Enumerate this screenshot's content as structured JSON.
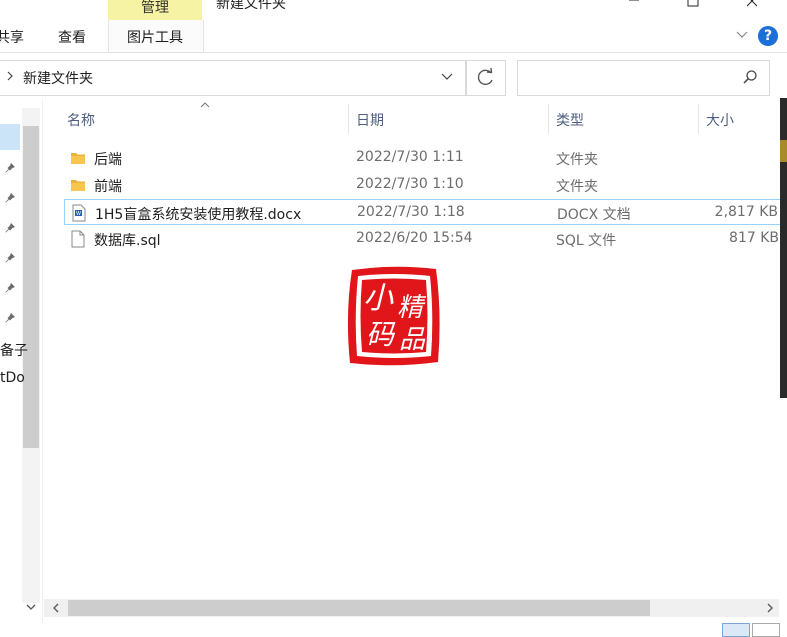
{
  "window": {
    "title": "新建文件夹",
    "context_tab": "管理",
    "context_group": "图片工具",
    "tabs": [
      "共享",
      "查看"
    ]
  },
  "address": {
    "path": "新建文件夹",
    "search_placeholder": ""
  },
  "columns": {
    "name": "名称",
    "date": "日期",
    "type": "类型",
    "size": "大小"
  },
  "files": [
    {
      "name": "后端",
      "date": "2022/7/30 1:11",
      "type": "文件夹",
      "size": "",
      "icon": "folder-icon"
    },
    {
      "name": "前端",
      "date": "2022/7/30 1:10",
      "type": "文件夹",
      "size": "",
      "icon": "folder-icon"
    },
    {
      "name": "1H5盲盒系统安装使用教程.docx",
      "date": "2022/7/30 1:18",
      "type": "DOCX 文档",
      "size": "2,817 KB",
      "icon": "word-document-icon"
    },
    {
      "name": "数据库.sql",
      "date": "2022/6/20 15:54",
      "type": "SQL 文件",
      "size": "817 KB",
      "icon": "text-file-icon"
    }
  ],
  "nav": {
    "partial_1": "备子",
    "partial_2": "tDo"
  },
  "watermark": {
    "chars": [
      "小",
      "精",
      "码",
      "品"
    ],
    "color": "#e0161b"
  },
  "colors": {
    "context_tab": "#f7f3a5",
    "selection_border": "#99d1ff",
    "help_blue": "#1c6fd6",
    "folder": "#e8b43a"
  }
}
